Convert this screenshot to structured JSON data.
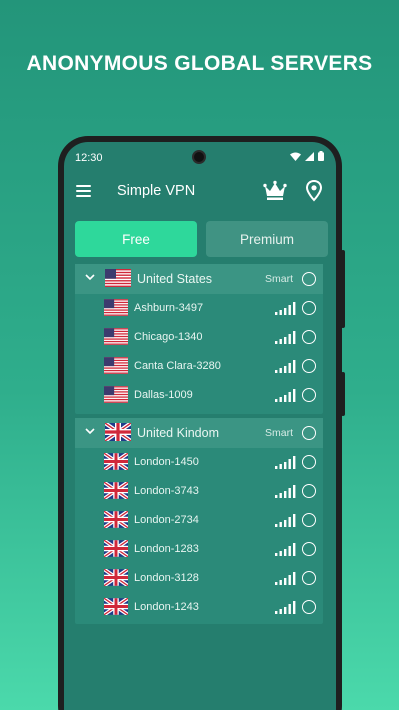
{
  "headline": "ANONYMOUS GLOBAL SERVERS",
  "status_bar": {
    "time": "12:30"
  },
  "app_bar": {
    "title": "Simple VPN"
  },
  "tabs": {
    "free_label": "Free",
    "premium_label": "Premium",
    "selected": "Free"
  },
  "groups": [
    {
      "country": "United States",
      "flag": "us",
      "smart_label": "Smart",
      "servers": [
        {
          "name": "Ashburn-3497",
          "signal": 5
        },
        {
          "name": "Chicago-1340",
          "signal": 5
        },
        {
          "name": "Canta Clara-3280",
          "signal": 5
        },
        {
          "name": "Dallas-1009",
          "signal": 5
        }
      ]
    },
    {
      "country": "United Kindom",
      "flag": "uk",
      "smart_label": "Smart",
      "servers": [
        {
          "name": "London-1450",
          "signal": 5
        },
        {
          "name": "London-3743",
          "signal": 5
        },
        {
          "name": "London-2734",
          "signal": 5
        },
        {
          "name": "London-1283",
          "signal": 5
        },
        {
          "name": "London-3128",
          "signal": 5
        },
        {
          "name": "London-1243",
          "signal": 5
        }
      ]
    }
  ],
  "colors": {
    "background_top": "#23957a",
    "background_bottom": "#4bd9ab",
    "screen": "#257e6e",
    "accent_free_tab": "#2ed89b",
    "premium_tab": "#409383"
  },
  "icons": [
    "menu-icon",
    "crown-icon",
    "location-pin-icon",
    "wifi-icon",
    "cell-signal-icon",
    "battery-icon",
    "chevron-down-icon",
    "signal-bars-icon",
    "radio-icon"
  ]
}
